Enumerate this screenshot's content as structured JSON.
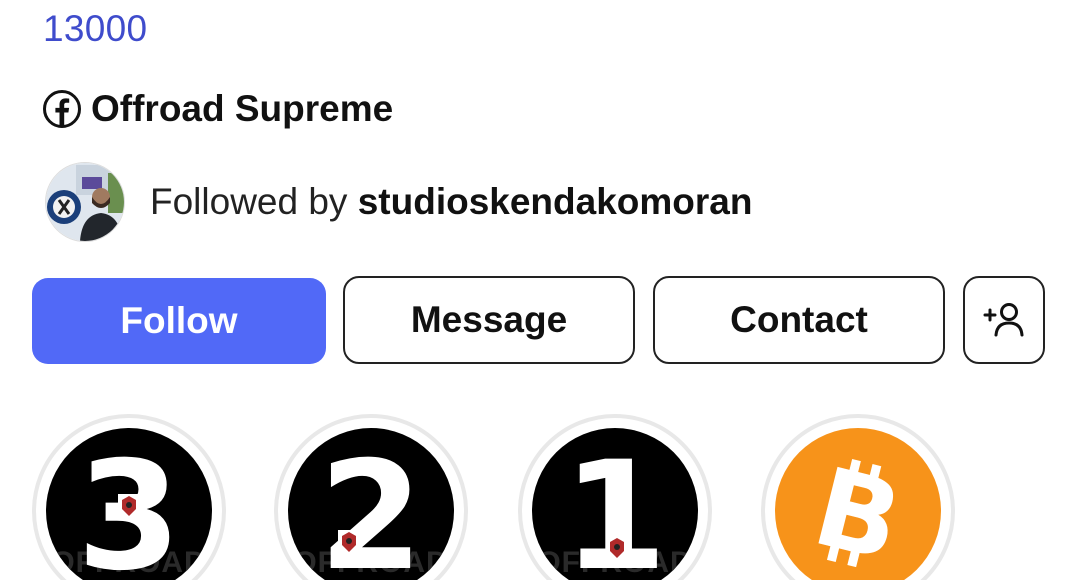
{
  "profile": {
    "count_link": "13000",
    "facebook_name": "Offroad Supreme",
    "followed_by_prefix": "Followed by ",
    "followed_by_user": "studioskendakomoran"
  },
  "actions": {
    "follow_label": "Follow",
    "message_label": "Message",
    "contact_label": "Contact"
  },
  "highlights": [
    {
      "number": "3",
      "watermark": "OFFROAD"
    },
    {
      "number": "2",
      "watermark": "OFFROAD"
    },
    {
      "number": "1",
      "watermark": "OFFROAD"
    },
    {
      "icon": "bitcoin-icon"
    }
  ],
  "colors": {
    "link_blue": "#3f4ccc",
    "follow_button": "#5169f7",
    "bitcoin_orange": "#f7931a"
  }
}
